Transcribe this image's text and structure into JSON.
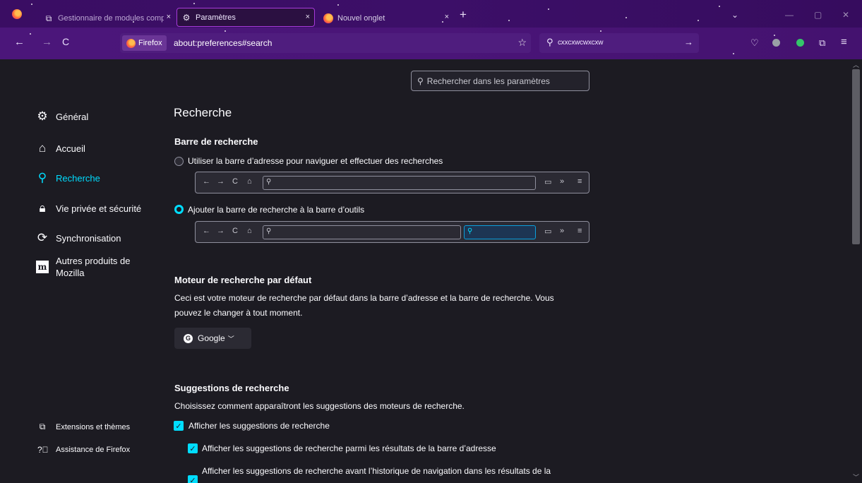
{
  "colors": {
    "accent": "#00ddff",
    "tab_bar_bg": "#3a0d63",
    "nav_bar_bg": "#4b167a",
    "content_bg": "#1c1b22"
  },
  "tabs": [
    {
      "label": "Gestionnaire de modules comp",
      "icon": "puzzle-icon",
      "close": "×"
    },
    {
      "label": "Paramètres",
      "icon": "gear-icon",
      "close": "×",
      "active": true
    },
    {
      "label": "Nouvel onglet",
      "icon": "firefox-icon",
      "close": "×"
    }
  ],
  "tabbar": {
    "new_tab": "+",
    "list_tabs": "⌄",
    "minimize": "—",
    "restore": "▢",
    "close": "✕"
  },
  "navbar": {
    "back": "←",
    "forward": "→",
    "reload": "C",
    "identity_label": "Firefox",
    "url": "about:preferences#search",
    "bookmark": "☆",
    "search_value": "cxxcxwcwxcxw",
    "search_go": "→"
  },
  "find": {
    "placeholder": "Rechercher dans les paramètres"
  },
  "sidebar": {
    "items": [
      {
        "label": "Général",
        "icon": "gear-icon"
      },
      {
        "label": "Accueil",
        "icon": "home-icon"
      },
      {
        "label": "Recherche",
        "icon": "search-icon",
        "selected": true
      },
      {
        "label": "Vie privée et sécurité",
        "icon": "lock-icon"
      },
      {
        "label": "Synchronisation",
        "icon": "sync-icon"
      },
      {
        "label_line1": "Autres produits de",
        "label_line2": "Mozilla",
        "icon": "mozilla-icon",
        "icon_text": "m"
      }
    ],
    "footer": [
      {
        "label": "Extensions et thèmes",
        "icon": "puzzle-icon"
      },
      {
        "label": "Assistance de Firefox",
        "icon": "help-icon"
      }
    ]
  },
  "main": {
    "title": "Recherche",
    "search_bar_section": {
      "heading": "Barre de recherche",
      "option_address": "Utiliser la barre d’adresse pour naviguer et effectuer des recherches",
      "option_toolbar": "Ajouter la barre de recherche à la barre d’outils",
      "selected": "toolbar"
    },
    "default_engine": {
      "heading": "Moteur de recherche par défaut",
      "description_line1": "Ceci est votre moteur de recherche par défaut dans la barre d’adresse et la barre de recherche. Vous",
      "description_line2": "pouvez le changer à tout moment.",
      "selected": "Google"
    },
    "suggestions": {
      "heading": "Suggestions de recherche",
      "description": "Choisissez comment apparaîtront les suggestions des moteurs de recherche.",
      "show_suggestions": "Afficher les suggestions de recherche",
      "in_address_bar": "Afficher les suggestions de recherche parmi les résultats de la barre d’adresse",
      "before_history": "Afficher les suggestions de recherche avant l’historique de navigation dans les résultats de la"
    }
  }
}
